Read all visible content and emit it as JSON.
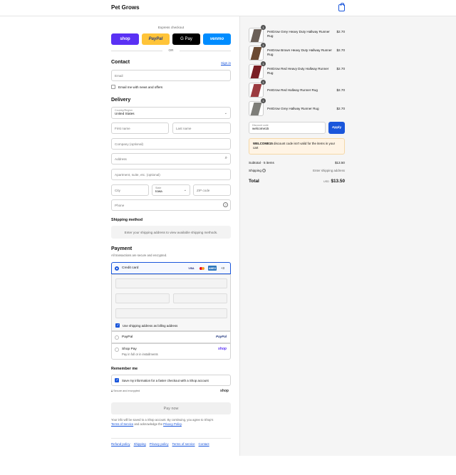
{
  "header": {
    "brand": "Pet Grows",
    "cart_icon": "bag-icon"
  },
  "express": {
    "label": "Express checkout",
    "buttons": [
      {
        "label": "shop",
        "bg": "#5a31f4",
        "fg": "#ffffff"
      },
      {
        "label": "PayPal",
        "bg": "#ffc439",
        "fg": "#253b80"
      },
      {
        "label": "G Pay",
        "bg": "#000000",
        "fg": "#ffffff"
      },
      {
        "label": "venmo",
        "bg": "#008cff",
        "fg": "#ffffff"
      }
    ],
    "or": "OR"
  },
  "contact": {
    "title": "Contact",
    "sign_in": "Sign in",
    "email_placeholder": "Email",
    "news_label": "Email me with news and offers"
  },
  "delivery": {
    "title": "Delivery",
    "country_label": "Country/Region",
    "country_value": "United States",
    "first_name": "First name",
    "last_name": "Last name",
    "company": "Company (optional)",
    "address": "Address",
    "apartment": "Apartment, suite, etc. (optional)",
    "city": "City",
    "state_label": "State",
    "state_value": "Iowa",
    "zip": "ZIP code",
    "phone": "Phone"
  },
  "shipping_method": {
    "title": "Shipping method",
    "message": "Enter your shipping address to view available shipping methods."
  },
  "payment": {
    "title": "Payment",
    "subtitle": "All transactions are secure and encrypted.",
    "credit_card": "Credit card",
    "card_brands": [
      "VISA",
      "MC",
      "AMEX"
    ],
    "more": "+3",
    "billing_label": "Use shipping address as billing address",
    "paypal": "PayPal",
    "shop_pay": "Shop Pay",
    "shop_pay_sub": "Pay in full or in installments",
    "paypal_logo": "PayPal",
    "shop_logo": "shop"
  },
  "remember": {
    "title": "Remember me",
    "save_label": "Save my information for a faster checkout with a Shop account",
    "secure": "Secure and encrypted",
    "shop_logo": "shop"
  },
  "pay_now": "Pay now",
  "legal": {
    "line1": "Your info will be saved to a Shop account. By continuing, you agree to Shop's",
    "tos": "Terms of Service",
    "and": " and acknowledge the ",
    "privacy": "Privacy Policy",
    "period": "."
  },
  "footer_links": [
    "Refund policy",
    "Shipping",
    "Privacy policy",
    "Terms of service",
    "Contact"
  ],
  "cart": {
    "items": [
      {
        "qty": "1",
        "title": "PetGrow Grey Heavy Duty Hallway Runner Rug",
        "price": "$2.70",
        "color": "#6b6058"
      },
      {
        "qty": "1",
        "title": "PetGrow Brown Heavy Duty Hallway Runner Rug",
        "price": "$2.70",
        "color": "#6b4a32"
      },
      {
        "qty": "1",
        "title": "PetGrow Red Heavy Duty Hallway Runner Rug",
        "price": "$2.70",
        "color": "#7a1e24"
      },
      {
        "qty": "1",
        "title": "PetGrow Red Hallway Runner Rug",
        "price": "$2.70",
        "color": "#9b3a3f"
      },
      {
        "qty": "1",
        "title": "PetGrow Grey Hallway Runner Rug",
        "price": "$2.70",
        "color": "#7d7d78"
      }
    ],
    "discount_label": "Discount code",
    "discount_value": "welcome15",
    "apply": "Apply",
    "warning_code": "WELCOME15",
    "warning_text": " discount code isn't valid for the items in your cart",
    "subtotal_label": "Subtotal · 5 items",
    "subtotal_value": "$13.50",
    "shipping_label": "Shipping",
    "shipping_value": "Enter shipping address",
    "total_label": "Total",
    "currency": "USD",
    "total_value": "$13.50"
  },
  "colors": {
    "accent": "#1a56db",
    "warning_bg": "#fff4e5"
  }
}
